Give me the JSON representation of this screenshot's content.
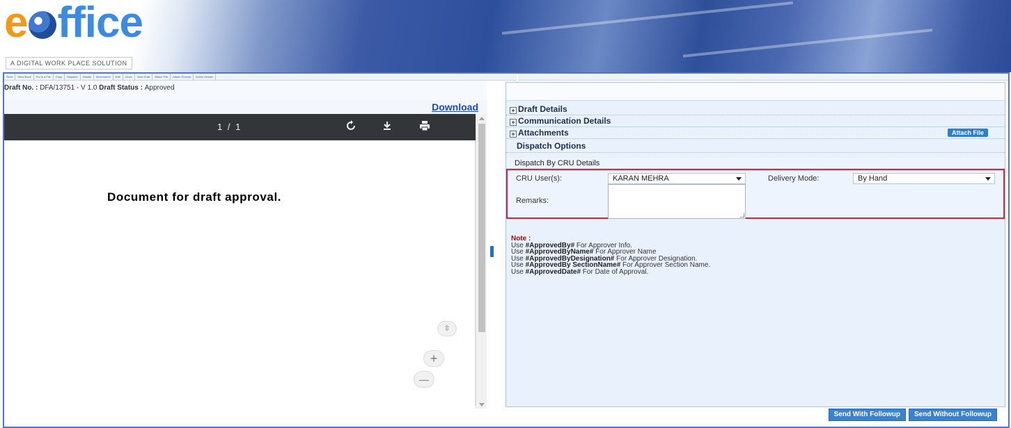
{
  "brand": {
    "logo_e": "e",
    "logo_rest": "ffice",
    "tagline": "A DIGITAL WORK PLACE SOLUTION"
  },
  "toolbar": {
    "items": [
      "Send",
      "Send Back",
      "Put in a File",
      "Copy",
      "Dispatch",
      "Details",
      "Movements",
      "Edit",
      "Close",
      "View Draft",
      "Attach File",
      "Attach Receipt",
      "Action Details"
    ]
  },
  "draft": {
    "number_label": "Draft No. : ",
    "number_value": "DFA/13751 - V 1.0",
    "status_label": "Draft Status : ",
    "status_value": "Approved"
  },
  "viewer": {
    "download_label": "Download",
    "page_count": "1 / 1",
    "document_text": "Document for draft approval.",
    "rotate_icon": "rotate-icon",
    "download_icon": "download-icon",
    "print_icon": "print-icon",
    "zoom_in": "+",
    "zoom_out": "—",
    "fit": "⇳"
  },
  "sections": {
    "draft_details": "Draft Details",
    "communication_details": "Communication Details",
    "attachments": "Attachments",
    "attach_file_button": "Attach File",
    "dispatch_options": "Dispatch Options",
    "dispatch_by_cru": "Dispatch By CRU Details"
  },
  "cru": {
    "user_label": "CRU User(s):",
    "user_value": "KARAN MEHRA",
    "delivery_label": "Delivery Mode:",
    "delivery_value": "By Hand",
    "remarks_label": "Remarks:",
    "remarks_value": ""
  },
  "notes": {
    "title": "Note :",
    "lines": [
      {
        "prefix": "Use ",
        "tag": "#ApprovedBy#",
        "desc": " For Approver Info."
      },
      {
        "prefix": "Use ",
        "tag": "#ApprovedByName#",
        "desc": " For Approver Name"
      },
      {
        "prefix": "Use ",
        "tag": "#ApprovedByDesignation#",
        "desc": " For Approver Designation."
      },
      {
        "prefix": "Use ",
        "tag": "#ApprovedBy SectionName#",
        "desc": " For Approver Section Name."
      },
      {
        "prefix": "Use ",
        "tag": "#ApprovedDate#",
        "desc": " For Date of Approval."
      }
    ]
  },
  "actions": {
    "send_with_followup": "Send With Followup",
    "send_without_followup": "Send Without Followup"
  },
  "colors": {
    "brand_orange": "#f29a17",
    "brand_blue": "#3c8be0",
    "frame_blue": "#4f77c7",
    "highlight_red": "#d6282e",
    "button_blue": "#3883d1",
    "link_blue": "#1d49c4"
  }
}
